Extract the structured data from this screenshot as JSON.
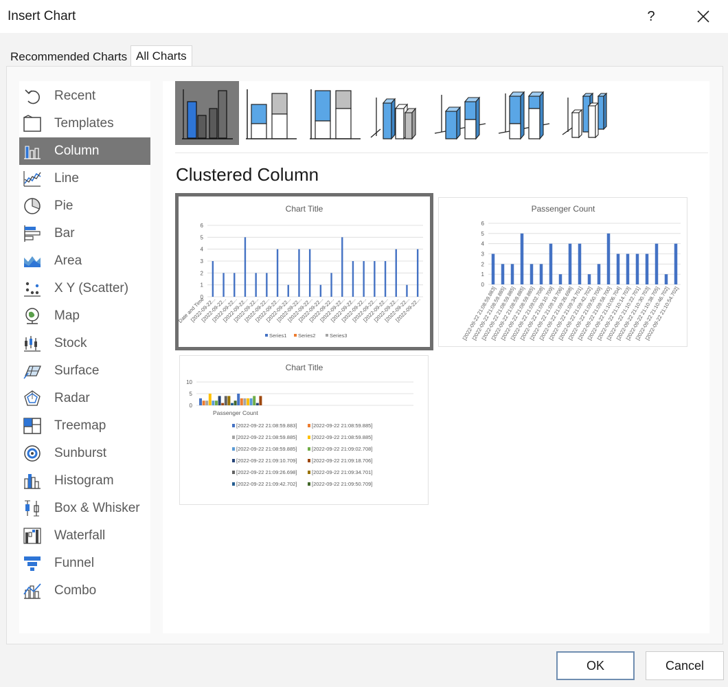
{
  "dialog": {
    "title": "Insert Chart",
    "help_glyph": "?"
  },
  "tabs": [
    {
      "label": "Recommended Charts"
    },
    {
      "label": "All Charts"
    }
  ],
  "chart_types": [
    {
      "label": "Recent",
      "icon": "recent-icon"
    },
    {
      "label": "Templates",
      "icon": "templates-icon"
    },
    {
      "label": "Column",
      "icon": "column-chart-icon"
    },
    {
      "label": "Line",
      "icon": "line-chart-icon"
    },
    {
      "label": "Pie",
      "icon": "pie-chart-icon"
    },
    {
      "label": "Bar",
      "icon": "bar-chart-icon"
    },
    {
      "label": "Area",
      "icon": "area-chart-icon"
    },
    {
      "label": "X Y (Scatter)",
      "icon": "scatter-chart-icon"
    },
    {
      "label": "Map",
      "icon": "map-chart-icon"
    },
    {
      "label": "Stock",
      "icon": "stock-chart-icon"
    },
    {
      "label": "Surface",
      "icon": "surface-chart-icon"
    },
    {
      "label": "Radar",
      "icon": "radar-chart-icon"
    },
    {
      "label": "Treemap",
      "icon": "treemap-chart-icon"
    },
    {
      "label": "Sunburst",
      "icon": "sunburst-chart-icon"
    },
    {
      "label": "Histogram",
      "icon": "histogram-chart-icon"
    },
    {
      "label": "Box & Whisker",
      "icon": "box-whisker-chart-icon"
    },
    {
      "label": "Waterfall",
      "icon": "waterfall-chart-icon"
    },
    {
      "label": "Funnel",
      "icon": "funnel-chart-icon"
    },
    {
      "label": "Combo",
      "icon": "combo-chart-icon"
    }
  ],
  "selected_type": "Column",
  "selected_subtype": "Clustered Column",
  "subtype_count": 7,
  "colors": {
    "accent_blue": "#4472c4",
    "orange": "#ed7d31",
    "gray": "#a5a5a5",
    "selection": "#777777"
  },
  "previews": [
    {
      "title": "Chart Title",
      "y_ticks": [
        "0",
        "1",
        "2",
        "3",
        "4",
        "5",
        "6"
      ],
      "x_first_label": "Date and Time",
      "x_label": "[2022-09-22...",
      "legend": [
        "Series1",
        "Series2",
        "Series3"
      ]
    },
    {
      "title": "Passenger Count",
      "y_ticks": [
        "0",
        "1",
        "2",
        "3",
        "4",
        "5",
        "6"
      ],
      "x_labels": [
        "[2022-09-22 21:08:59.883]",
        "[2022-09-22 21:08:59.885]",
        "[2022-09-22 21:08:59.885]",
        "[2022-09-22 21:08:59.885]",
        "[2022-09-22 21:08:59.885]",
        "[2022-09-22 21:09:02.708]",
        "[2022-09-22 21:09:10.709]",
        "[2022-09-22 21:09:18.706]",
        "[2022-09-22 21:09:26.698]",
        "[2022-09-22 21:09:34.701]",
        "[2022-09-22 21:09:42.702]",
        "[2022-09-22 21:09:50.709]",
        "[2022-09-22 21:09:58.700]",
        "[2022-09-22 21:10:06.704]",
        "[2022-09-22 21:10:14.703]",
        "[2022-09-22 21:10:22.701]",
        "[2022-09-22 21:10:30.703]",
        "[2022-09-22 21:10:38.705]",
        "[2022-09-22 21:10:46.702]",
        "[2022-09-22 21:10:54.702]"
      ]
    },
    {
      "title": "Chart Title",
      "y_ticks": [
        "0",
        "5",
        "10"
      ],
      "x_label": "Passenger Count",
      "legend": [
        {
          "name": "[2022-09-22 21:08:59.883]",
          "color": "#4472c4"
        },
        {
          "name": "[2022-09-22 21:08:59.885]",
          "color": "#ed7d31"
        },
        {
          "name": "[2022-09-22 21:08:59.885]",
          "color": "#a5a5a5"
        },
        {
          "name": "[2022-09-22 21:08:59.885]",
          "color": "#ffc000"
        },
        {
          "name": "[2022-09-22 21:08:59.885]",
          "color": "#5b9bd5"
        },
        {
          "name": "[2022-09-22 21:09:02.708]",
          "color": "#70ad47"
        },
        {
          "name": "[2022-09-22 21:09:10.709]",
          "color": "#264478"
        },
        {
          "name": "[2022-09-22 21:09:18.706]",
          "color": "#9e480e"
        },
        {
          "name": "[2022-09-22 21:09:26.698]",
          "color": "#636363"
        },
        {
          "name": "[2022-09-22 21:09:34.701]",
          "color": "#997300"
        },
        {
          "name": "[2022-09-22 21:09:42.702]",
          "color": "#255e91"
        },
        {
          "name": "[2022-09-22 21:09:50.709]",
          "color": "#43682b"
        }
      ]
    }
  ],
  "chart_data": [
    {
      "type": "bar",
      "ylim": [
        0,
        6
      ],
      "series": [
        {
          "values": [
            3,
            2,
            2,
            5,
            2,
            2,
            4,
            1,
            4,
            4,
            1,
            2,
            5,
            3,
            3,
            3,
            3,
            4,
            1,
            4
          ]
        }
      ]
    },
    {
      "type": "bar",
      "ylim": [
        0,
        6
      ],
      "series": [
        {
          "values": [
            3,
            2,
            2,
            5,
            2,
            2,
            4,
            1,
            4,
            4,
            1,
            2,
            5,
            3,
            3,
            3,
            3,
            4,
            1,
            4
          ]
        }
      ]
    },
    {
      "type": "bar",
      "ylim": [
        0,
        10
      ],
      "values": [
        3,
        2,
        2,
        5,
        2,
        2,
        4,
        1,
        4,
        4,
        1,
        2,
        5,
        3,
        3,
        3,
        3,
        4,
        1,
        4
      ]
    }
  ],
  "buttons": {
    "ok": "OK",
    "cancel": "Cancel"
  }
}
